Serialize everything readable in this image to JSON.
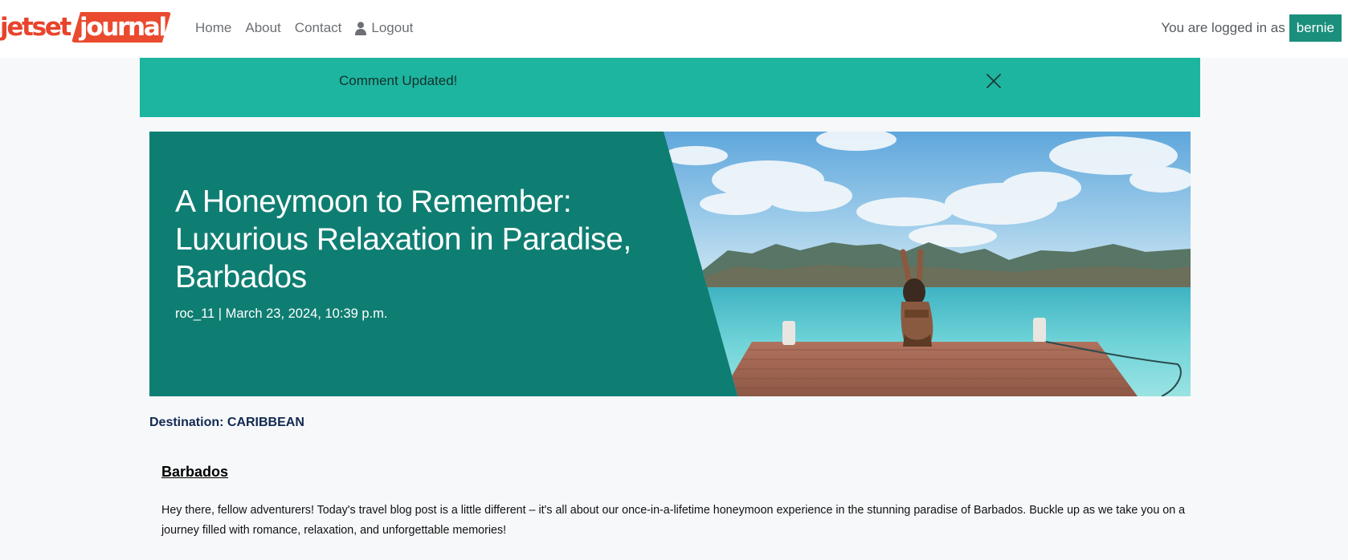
{
  "brand": {
    "part1": "jetset",
    "part2": "journal",
    "colors": {
      "brand_red": "#ea4a2e"
    }
  },
  "nav": {
    "items": [
      {
        "label": "Home"
      },
      {
        "label": "About"
      },
      {
        "label": "Contact"
      },
      {
        "label": "Logout",
        "icon": "user-icon"
      }
    ]
  },
  "login": {
    "text": "You are logged in as",
    "username": "bernie",
    "badge_color": "#1a8f7c"
  },
  "alert": {
    "message": "Comment Updated!",
    "close_icon": "close-icon",
    "background": "#1db5a0"
  },
  "post": {
    "title": "A Honeymoon to Remember: Luxurious Relaxation in Paradise, Barbados",
    "meta": "roc_11 | March 23, 2024, 10:39 p.m.",
    "panel_color": "#0f7e72",
    "image": "woman-on-pier-ocean-mountains",
    "destination": "Destination: CARIBBEAN",
    "section_heading": "Barbados",
    "paragraph": "Hey there, fellow adventurers! Today's travel blog post is a little different – it's all about our once-in-a-lifetime honeymoon experience in the stunning paradise of Barbados. Buckle up as we take you on a journey filled with romance, relaxation, and unforgettable memories!"
  }
}
